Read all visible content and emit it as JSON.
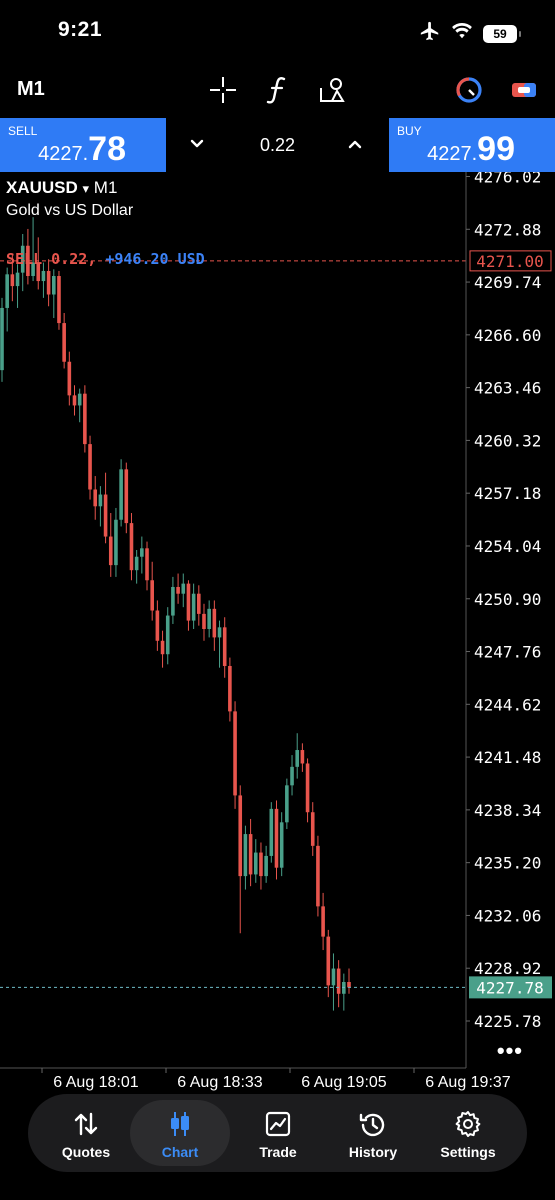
{
  "status_bar": {
    "time": "9:21",
    "battery": "59"
  },
  "toolbar": {
    "timeframe": "M1"
  },
  "trade": {
    "sell_label": "SELL",
    "sell_price_small": "4227.",
    "sell_price_big": "78",
    "volume": "0.22",
    "buy_label": "BUY",
    "buy_price_small": "4227.",
    "buy_price_big": "99"
  },
  "chart": {
    "symbol": "XAUUSD",
    "symbol_arrow": "▾",
    "timeframe": "M1",
    "description": "Gold vs US Dollar",
    "position_side_volume": "SELL 0.22,",
    "position_profit": "+946.20 USD",
    "more": "•••"
  },
  "chart_data": {
    "type": "candlestick",
    "y_ticks": [
      "4276.02",
      "4272.88",
      "4269.74",
      "4266.60",
      "4263.46",
      "4260.32",
      "4257.18",
      "4254.04",
      "4250.90",
      "4247.76",
      "4244.62",
      "4241.48",
      "4238.34",
      "4235.20",
      "4232.06",
      "4228.92",
      "4225.78"
    ],
    "ylim": [
      4224.2,
      4277.6
    ],
    "x_ticks": [
      "6 Aug 18:01",
      "6 Aug 18:33",
      "6 Aug 19:05",
      "6 Aug 19:37"
    ],
    "position_price": "4271.00",
    "current_price": "4227.78",
    "up_color": "#4aa08a",
    "down_color": "#e8554d",
    "position_line_color": "#e8554d",
    "price_line_color": "#6fbcc7",
    "candles_ohlc": [
      [
        4264.5,
        4268.8,
        4263.8,
        4268.2
      ],
      [
        4268.2,
        4270.6,
        4266.8,
        4270.2
      ],
      [
        4270.2,
        4271.4,
        4268.6,
        4269.5
      ],
      [
        4269.5,
        4270.8,
        4268.2,
        4270.3
      ],
      [
        4270.3,
        4272.6,
        4269.2,
        4271.9
      ],
      [
        4271.9,
        4272.9,
        4269.6,
        4270.1
      ],
      [
        4270.1,
        4273.6,
        4269.8,
        4270.9
      ],
      [
        4270.9,
        4272.4,
        4269.3,
        4269.8
      ],
      [
        4269.8,
        4270.9,
        4268.8,
        4270.4
      ],
      [
        4270.4,
        4271.1,
        4268.3,
        4269.0
      ],
      [
        4269.0,
        4270.5,
        4267.6,
        4270.1
      ],
      [
        4270.1,
        4270.4,
        4266.9,
        4267.3
      ],
      [
        4267.3,
        4267.9,
        4264.6,
        4265.0
      ],
      [
        4265.0,
        4265.6,
        4262.4,
        4263.0
      ],
      [
        4263.0,
        4263.6,
        4261.8,
        4262.4
      ],
      [
        4262.4,
        4263.4,
        4261.4,
        4263.1
      ],
      [
        4263.1,
        4263.6,
        4259.6,
        4260.1
      ],
      [
        4260.1,
        4260.6,
        4256.8,
        4257.4
      ],
      [
        4257.4,
        4258.2,
        4255.6,
        4256.4
      ],
      [
        4256.4,
        4257.6,
        4255.2,
        4257.1
      ],
      [
        4257.1,
        4258.4,
        4254.2,
        4254.6
      ],
      [
        4254.6,
        4256.0,
        4252.2,
        4252.9
      ],
      [
        4252.9,
        4256.3,
        4252.2,
        4255.6
      ],
      [
        4255.6,
        4259.2,
        4255.2,
        4258.6
      ],
      [
        4258.6,
        4259.0,
        4254.8,
        4255.4
      ],
      [
        4255.4,
        4256.0,
        4252.0,
        4252.6
      ],
      [
        4252.6,
        4253.8,
        4251.8,
        4253.4
      ],
      [
        4253.4,
        4254.6,
        4252.4,
        4253.9
      ],
      [
        4253.9,
        4254.3,
        4251.4,
        4252.0
      ],
      [
        4252.0,
        4253.1,
        4249.6,
        4250.2
      ],
      [
        4250.2,
        4250.8,
        4247.8,
        4248.4
      ],
      [
        4248.4,
        4249.0,
        4246.8,
        4247.6
      ],
      [
        4247.6,
        4250.4,
        4247.0,
        4249.9
      ],
      [
        4249.9,
        4252.2,
        4249.4,
        4251.6
      ],
      [
        4251.6,
        4252.4,
        4250.6,
        4251.2
      ],
      [
        4251.2,
        4252.4,
        4250.4,
        4251.8
      ],
      [
        4251.8,
        4252.0,
        4249.0,
        4249.6
      ],
      [
        4249.6,
        4251.8,
        4249.1,
        4251.2
      ],
      [
        4251.2,
        4251.7,
        4249.3,
        4250.0
      ],
      [
        4250.0,
        4250.6,
        4248.4,
        4249.1
      ],
      [
        4249.1,
        4250.8,
        4248.6,
        4250.3
      ],
      [
        4250.3,
        4250.8,
        4247.8,
        4248.6
      ],
      [
        4248.6,
        4249.6,
        4246.8,
        4249.2
      ],
      [
        4249.2,
        4249.8,
        4246.2,
        4246.9
      ],
      [
        4246.9,
        4247.4,
        4243.6,
        4244.2
      ],
      [
        4244.2,
        4244.8,
        4238.4,
        4239.2
      ],
      [
        4239.2,
        4239.8,
        4231.0,
        4234.4
      ],
      [
        4234.4,
        4237.4,
        4233.6,
        4236.9
      ],
      [
        4236.9,
        4237.8,
        4233.8,
        4234.5
      ],
      [
        4234.5,
        4236.6,
        4234.0,
        4235.8
      ],
      [
        4235.8,
        4236.4,
        4233.6,
        4234.4
      ],
      [
        4234.4,
        4236.2,
        4234.0,
        4235.6
      ],
      [
        4235.6,
        4238.8,
        4235.2,
        4238.4
      ],
      [
        4238.4,
        4238.9,
        4234.2,
        4234.9
      ],
      [
        4234.9,
        4238.2,
        4234.4,
        4237.6
      ],
      [
        4237.6,
        4240.2,
        4237.2,
        4239.8
      ],
      [
        4239.8,
        4241.6,
        4239.2,
        4240.9
      ],
      [
        4240.9,
        4242.9,
        4240.2,
        4241.9
      ],
      [
        4241.9,
        4242.3,
        4240.6,
        4241.1
      ],
      [
        4241.1,
        4241.4,
        4237.6,
        4238.2
      ],
      [
        4238.2,
        4238.8,
        4235.6,
        4236.2
      ],
      [
        4236.2,
        4236.8,
        4232.0,
        4232.6
      ],
      [
        4232.6,
        4233.4,
        4230.0,
        4230.8
      ],
      [
        4230.8,
        4231.2,
        4227.2,
        4227.9
      ],
      [
        4227.9,
        4229.8,
        4226.4,
        4228.9
      ],
      [
        4228.9,
        4229.4,
        4226.6,
        4227.4
      ],
      [
        4227.4,
        4228.6,
        4226.4,
        4228.1
      ],
      [
        4228.1,
        4228.9,
        4227.4,
        4227.78
      ]
    ]
  },
  "nav": {
    "items": [
      {
        "label": "Quotes"
      },
      {
        "label": "Chart"
      },
      {
        "label": "Trade"
      },
      {
        "label": "History"
      },
      {
        "label": "Settings"
      }
    ]
  }
}
